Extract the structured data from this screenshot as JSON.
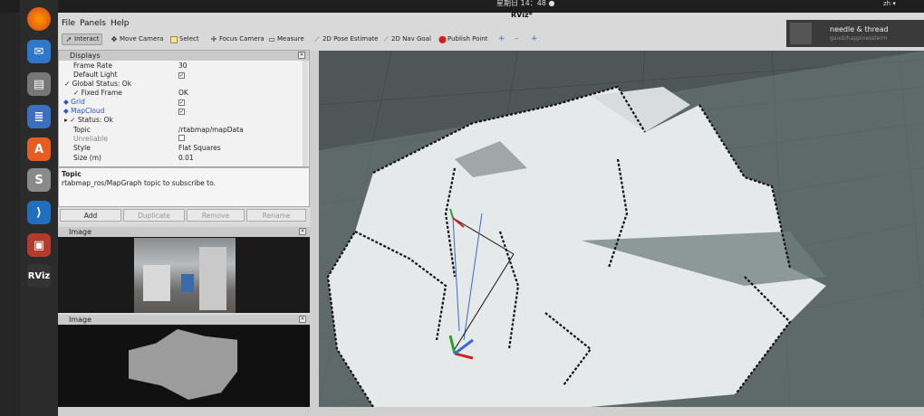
{
  "topbar": {
    "clock": "星期日 14：48 ●",
    "keyboard": "zh ▾"
  },
  "window": {
    "title": "RViz*"
  },
  "menu": {
    "file": "File",
    "panels": "Panels",
    "help": "Help"
  },
  "toolbar": {
    "interact": "Interact",
    "move_camera": "Move Camera",
    "select": "Select",
    "focus_camera": "Focus Camera",
    "measure": "Measure",
    "pose_estimate": "2D Pose Estimate",
    "nav_goal": "2D Nav Goal",
    "publish_point": "Publish Point",
    "plus": "+",
    "minus": "–",
    "more": "+"
  },
  "notification": {
    "title": "needle & thread",
    "subtitle": "gaudi/happinessterm"
  },
  "displays": {
    "title": "Displays",
    "rows": [
      {
        "key": "Frame Rate",
        "value": "30"
      },
      {
        "key": "Default Light",
        "value": "✓"
      },
      {
        "key": "Global Status: Ok",
        "value": ""
      },
      {
        "key": "Fixed Frame",
        "value": "OK"
      },
      {
        "key": "Grid",
        "value": "✓"
      },
      {
        "key": "MapCloud",
        "value": "✓"
      },
      {
        "key": "Status: Ok",
        "value": ""
      },
      {
        "key": "Topic",
        "value": "/rtabmap/mapData"
      },
      {
        "key": "Unreliable",
        "value": ""
      },
      {
        "key": "Style",
        "value": "Flat Squares"
      },
      {
        "key": "Size (m)",
        "value": "0.01"
      }
    ]
  },
  "description": {
    "heading": "Topic",
    "text": "rtabmap_ros/MapGraph topic to subscribe to."
  },
  "buttons": {
    "add": "Add",
    "duplicate": "Duplicate",
    "remove": "Remove",
    "rename": "Rename"
  },
  "image_panels": {
    "panel1": "Image",
    "panel2": "Image"
  },
  "dock": {
    "rviz_label": "RViz"
  },
  "colors": {
    "grid_bg": "#4d5354",
    "map_free": "#e6e9ea",
    "map_wall": "#0d0d0d",
    "shadow": "#6a7878"
  }
}
